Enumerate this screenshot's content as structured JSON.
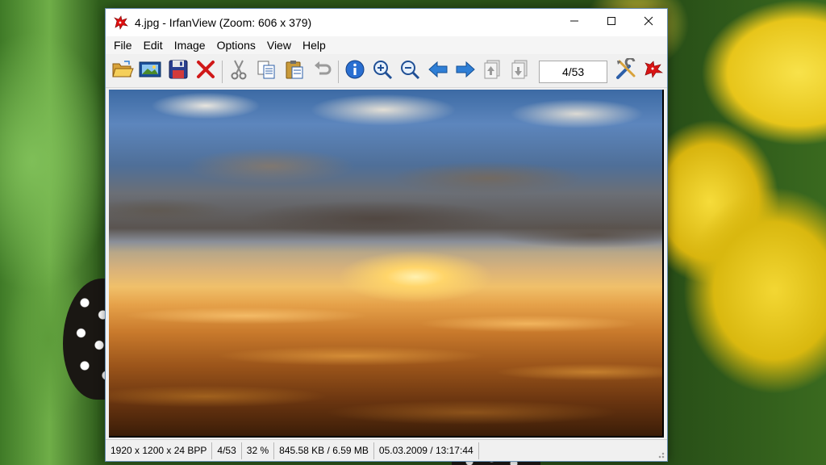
{
  "window": {
    "title": "4.jpg - IrfanView (Zoom: 606 x 379)",
    "app_icon": "irfanview-red-cat-icon",
    "controls": {
      "minimize": "—",
      "maximize": "☐",
      "close": "✕"
    }
  },
  "menu": [
    {
      "label": "File"
    },
    {
      "label": "Edit"
    },
    {
      "label": "Image"
    },
    {
      "label": "Options"
    },
    {
      "label": "View"
    },
    {
      "label": "Help"
    }
  ],
  "toolbar": {
    "counter": "4/53",
    "buttons": [
      "open-folder-icon",
      "slideshow-icon",
      "save-icon",
      "delete-icon",
      "cut-icon",
      "copy-icon",
      "paste-icon",
      "undo-icon",
      "info-icon",
      "zoom-in-icon",
      "zoom-out-icon",
      "previous-icon",
      "next-icon",
      "previous-page-icon",
      "next-page-icon",
      "properties-icon",
      "about-icon"
    ]
  },
  "image": {
    "description_icon": "sunset-photo",
    "colors": {
      "sky": "#3c6aa4",
      "sun": "#ffd56a",
      "ground": "#6a3510"
    }
  },
  "status": {
    "dimensions": "1920 x 1200 x 24 BPP",
    "index": "4/53",
    "zoom": "32 %",
    "size": "845.58 KB / 6.59 MB",
    "date": "05.03.2009 / 13:17:44"
  }
}
